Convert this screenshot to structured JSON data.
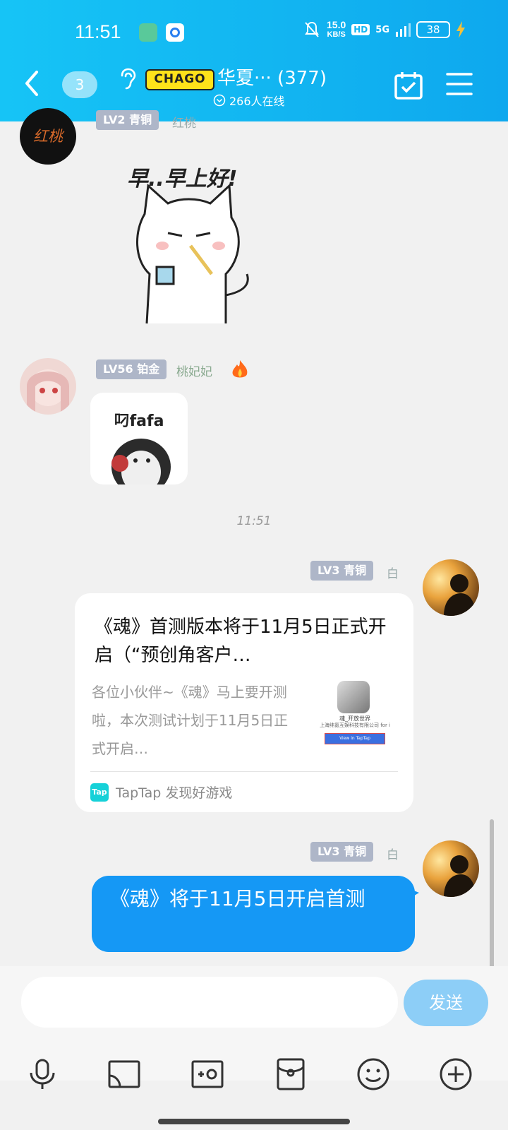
{
  "status_bar": {
    "time": "11:51",
    "net_speed_value": "15.0",
    "net_speed_unit": "KB/S",
    "hd": "HD",
    "network": "5G",
    "battery": "38"
  },
  "header": {
    "unread_count": "3",
    "logo_text": "CHAGO",
    "group_title": "华夏··· (377)",
    "online_count": "266人在线",
    "accent": "#12b5f1"
  },
  "messages": [
    {
      "level": "LV2 青铜",
      "nickname": "红桃",
      "avatar_text": "红桃",
      "sticker_text": "早..早上好!"
    },
    {
      "level": "LV56 铂金",
      "nickname": "桃妃妃",
      "sticker_text": "叼fafa"
    },
    {
      "timestamp": "11:51"
    },
    {
      "level": "LV3 青铜",
      "nickname": "白",
      "card_title": "《魂》首测版本将于11月5日正式开启（“预创角客户…",
      "card_desc": "各位小伙伴~《魂》马上要开测啦，本次测试计划于11月5日正式开启…",
      "thumb_caption": "魂_开放世界",
      "thumb_company": "上海纬氪互娱科技有限公司 for i",
      "thumb_button": "View in TapTap",
      "source_logo": "Tap",
      "source_name": "TapTap 发现好游戏"
    },
    {
      "level": "LV3 青铜",
      "nickname": "白",
      "text": "《魂》将于11月5日开启首测"
    }
  ],
  "composer": {
    "input_value": "",
    "send_label": "发送",
    "send_color": "#8dcef7"
  },
  "toolbar_icons": [
    "microphone-icon",
    "screen-cast-icon",
    "photo-icon",
    "red-packet-icon",
    "emoji-icon",
    "plus-icon"
  ]
}
